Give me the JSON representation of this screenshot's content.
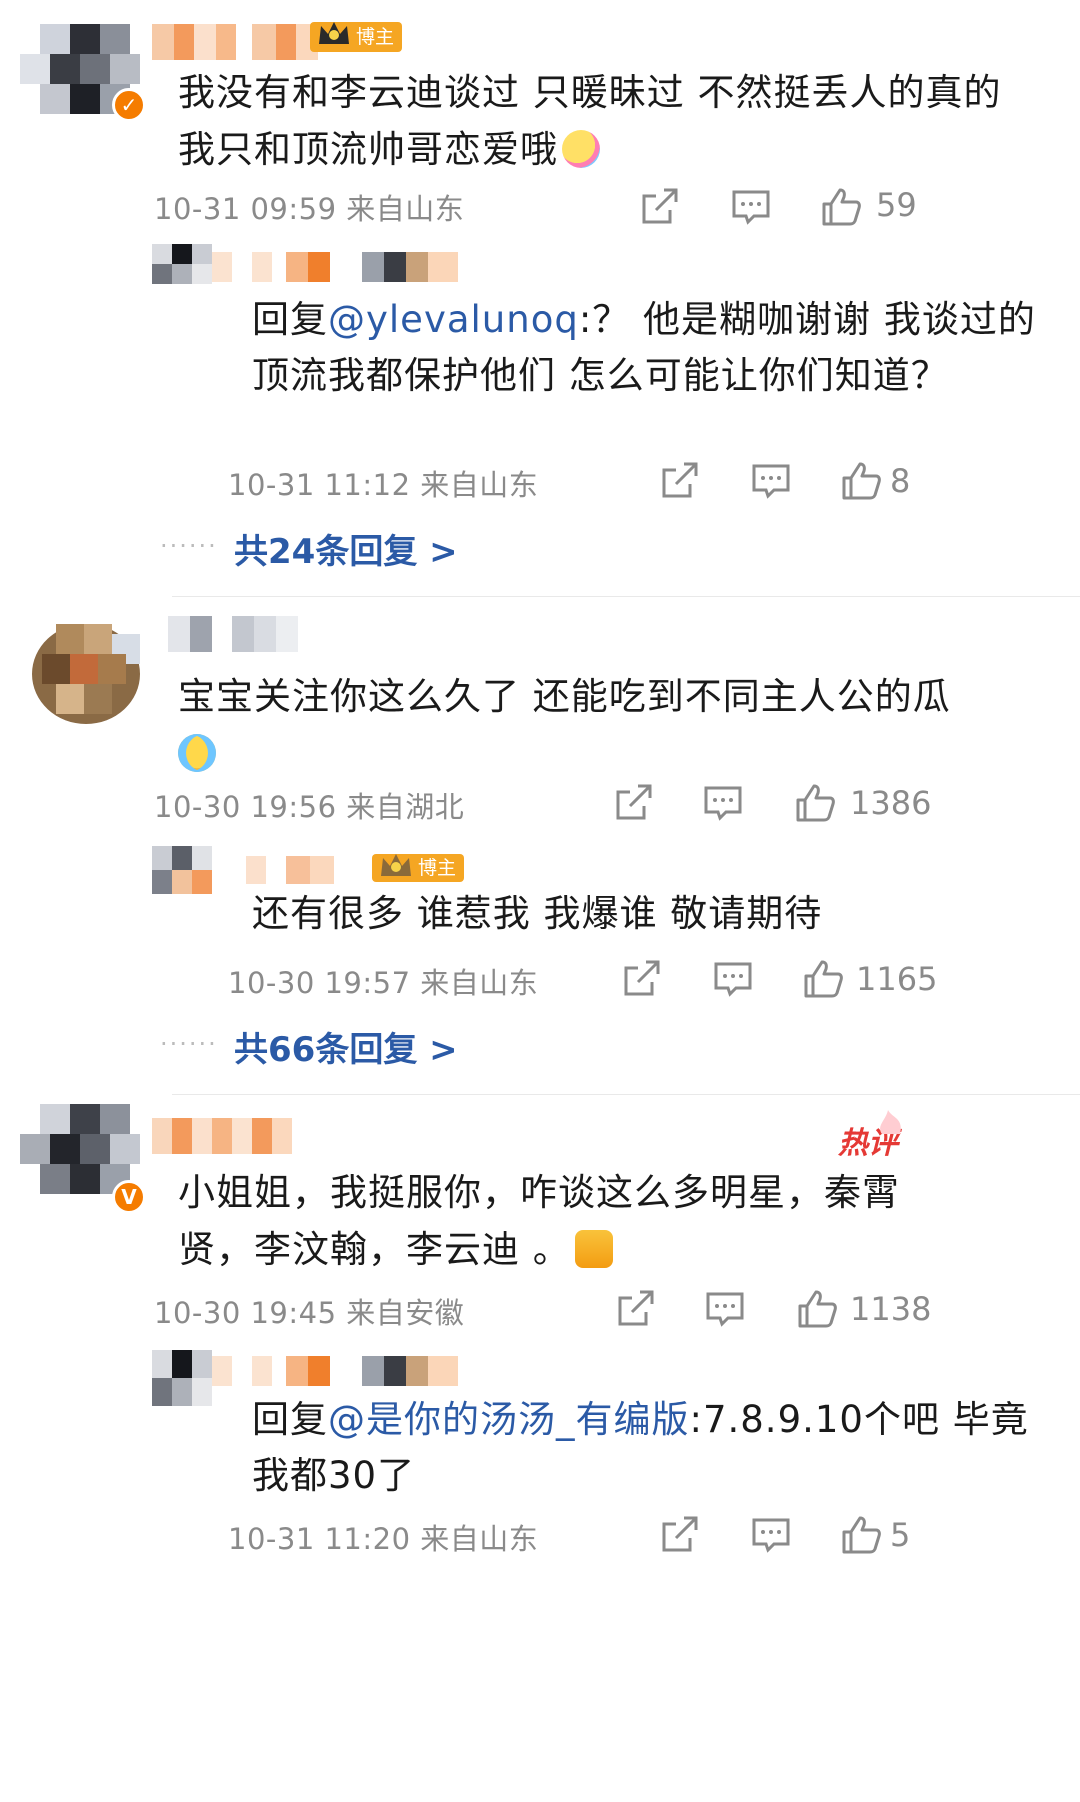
{
  "threads": [
    {
      "badge": "博主",
      "text": "我没有和李云迪谈过 只暖昧过 不然挺丢人的真的 我只和顶流帅哥恋爱哦",
      "emoji": "rainbow-kiss-emoji",
      "time_location": "10-31 09:59 来自山东",
      "likes": "59",
      "reply": {
        "prefix": "回复",
        "mention": "@ylevalunoq",
        "text": ":？ 他是糊咖谢谢 我谈过的顶流我都保护他们 怎么可能让你们知道？",
        "time_location": "10-31 11:12 来自山东",
        "likes": "8"
      },
      "more_dots": "······",
      "more_replies": "共24条回复 >"
    },
    {
      "text": "宝宝关注你这么久了 还能吃到不同主人公的瓜",
      "emoji": "crying-face-emoji",
      "time_location": "10-30 19:56 来自湖北",
      "likes": "1386",
      "reply": {
        "badge": "博主",
        "text": "还有很多 谁惹我 我爆谁 敬请期待",
        "time_location": "10-30 19:57 来自山东",
        "likes": "1165"
      },
      "more_dots": "······",
      "more_replies": "共66条回复 >"
    },
    {
      "hot_label": "热评",
      "text": "小姐姐，我挺服你，咋谈这么多明星，秦霄贤，李汶翰，李云迪 。",
      "emoji": "thumbs-up-emoji",
      "time_location": "10-30 19:45 来自安徽",
      "likes": "1138",
      "reply": {
        "prefix": "回复",
        "mention": "@是你的汤汤_有编版",
        "text": ":7.8.9.10个吧 毕竟我都30了",
        "time_location": "10-31 11:20 来自山东",
        "likes": "5"
      }
    }
  ],
  "icons": {
    "share": "share-icon",
    "comment": "comment-icon",
    "like": "like-icon"
  },
  "colors": {
    "link": "#2b5aa6",
    "meta": "#8a8a8a",
    "blogger_badge": "#f5a623",
    "hot": "#e53935"
  }
}
